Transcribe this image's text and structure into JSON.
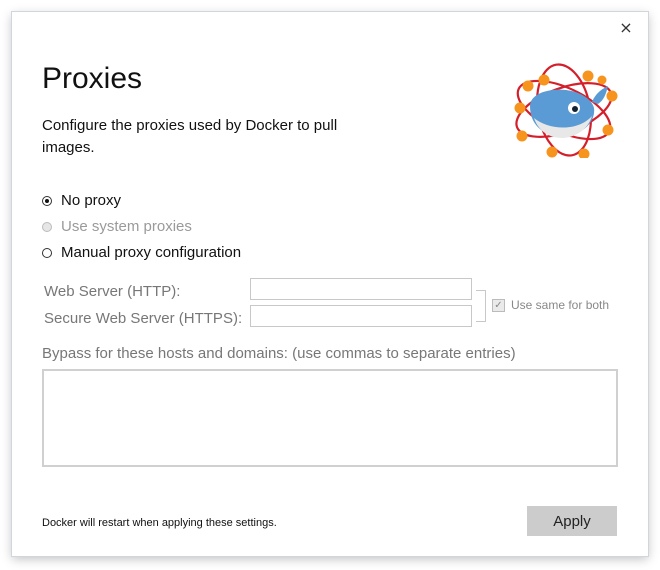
{
  "dialog": {
    "title": "Proxies",
    "subtitle": "Configure the proxies used by Docker to pull images.",
    "close_icon": "×"
  },
  "proxy_options": [
    {
      "label": "No proxy",
      "checked": true,
      "disabled": false
    },
    {
      "label": "Use system proxies",
      "checked": false,
      "disabled": true
    },
    {
      "label": "Manual proxy configuration",
      "checked": false,
      "disabled": false
    }
  ],
  "fields": {
    "http_label": "Web Server (HTTP):",
    "http_value": "",
    "https_label": "Secure Web Server (HTTPS):",
    "https_value": "",
    "same_for_both_label": "Use same for both",
    "same_for_both_checked": true
  },
  "bypass": {
    "label": "Bypass for these hosts and domains: (use commas to separate entries)",
    "value": ""
  },
  "footer": {
    "note": "Docker will restart when applying these settings.",
    "apply_label": "Apply"
  },
  "colors": {
    "orbit_red": "#d41f2b",
    "node_orange": "#f7941d",
    "whale_blue": "#5b9bd5",
    "button_gray": "#cccccc"
  }
}
